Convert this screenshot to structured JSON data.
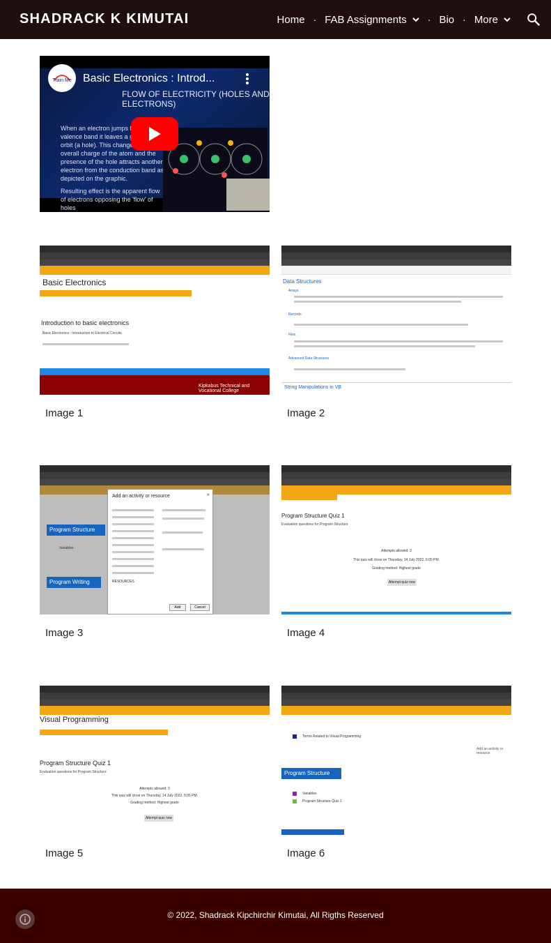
{
  "header": {
    "site_title": "SHADRACK K KIMUTAI",
    "nav": {
      "home": "Home",
      "fab": "FAB Assignments",
      "bio": "Bio",
      "more": "More"
    }
  },
  "video": {
    "title": "Basic Electronics : Introd...",
    "subtitle": "FLOW OF ELECTRICITY (HOLES AND ELECTRONS)",
    "channel_logo_text": "Train Me",
    "bullet_1": "When an electron jumps from a valence band it leaves a gap in its orbit (a hole). This changes the overall charge of the atom and the presence of the hole attracts another electron from the conduction band as depicted on the graphic.",
    "bullet_2": "Resulting effect is the apparent flow of electrons opposing the 'flow' of holes"
  },
  "gallery": {
    "items": [
      {
        "caption": "Image 1"
      },
      {
        "caption": "Image 2"
      },
      {
        "caption": "Image 3"
      },
      {
        "caption": "Image 4"
      },
      {
        "caption": "Image 5"
      },
      {
        "caption": "Image 6"
      }
    ]
  },
  "screens": {
    "img1": {
      "heading": "Basic Electronics",
      "topic": "Introduction to basic electronics",
      "line": "Basic Electronics : Introduction to Electrical Circuits",
      "college": "Kipkabus Technical and Vocational College"
    },
    "img2": {
      "heading": "Data Structures",
      "item_arrays": "Arrays",
      "item_records": "Records",
      "item_files": "Files",
      "item_advanced": "Advanced Data Structures",
      "footer_link": "String Manipulations in VB"
    },
    "img3": {
      "dialog_title": "Add an activity or resource",
      "section_1": "Program Structure",
      "item": "Variables",
      "section_2": "Program Writing",
      "resources_label": "RESOURCES",
      "add_btn": "Add",
      "cancel_btn": "Cancel"
    },
    "img4": {
      "heading": "Program Structure Quiz 1",
      "sub": "Evaluation questions for Program Structure",
      "attempts": "Attempts allowed: 3",
      "close": "This quiz will close on Thursday, 14 July 2022, 5:05 PM.",
      "grading": "Grading method: Highest grade",
      "btn": "Attempt quiz now"
    },
    "img5": {
      "heading": "Visual Programming",
      "title": "Program Structure Quiz 1",
      "sub": "Evaluation questions for Program Structure",
      "attempts": "Attempts allowed: 3",
      "close": "This quiz will close on Thursday, 14 July 2022, 5:05 PM.",
      "grading": "Grading method: Highest grade",
      "btn": "Attempt quiz now"
    },
    "img6": {
      "row1": "Terms Related to Visual Programming",
      "section": "Program Structure",
      "item1": "Variables",
      "item2": "Program Structure Quiz 1",
      "add": "Add an activity or resource"
    }
  },
  "footer": {
    "copyright": "© 2022, Shadrack Kipchirchir Kimutai, All Rigths Reserved"
  },
  "colors": {
    "header_bg": "#1f0f0f",
    "footer_bg": "#3a0000",
    "moodle_orange": "#f3a712",
    "moodle_blue": "#1e88e5"
  }
}
